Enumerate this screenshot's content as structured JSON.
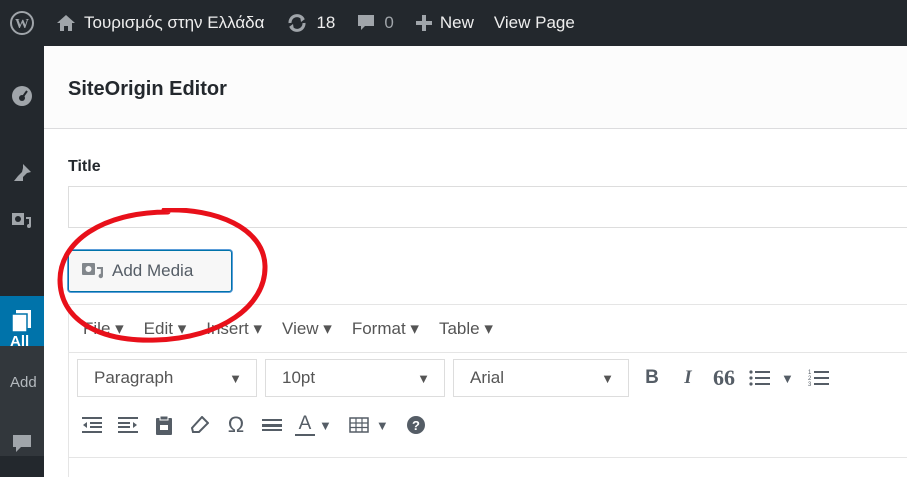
{
  "adminbar": {
    "site_name": "Τουρισμός στην Ελλάδα",
    "updates_count": "18",
    "comments_count": "0",
    "new_label": "New",
    "view_page_label": "View Page"
  },
  "adminmenu": {
    "sub_all": "All",
    "sub_add": "Add"
  },
  "dialog": {
    "title": "SiteOrigin Editor",
    "field_title_label": "Title",
    "field_title_value": "",
    "add_media_label": "Add Media"
  },
  "editor": {
    "menu": [
      "File",
      "Edit",
      "Insert",
      "View",
      "Format",
      "Table"
    ],
    "format_select": "Paragraph",
    "size_select": "10pt",
    "font_select": "Arial",
    "bold": "B",
    "italic": "I",
    "blockquote": "66",
    "special_char": "Ω",
    "text_color": "A"
  },
  "colors": {
    "adminbar_bg": "#23282d",
    "accent_blue": "#0073aa",
    "annotation_red": "#e8101a"
  }
}
